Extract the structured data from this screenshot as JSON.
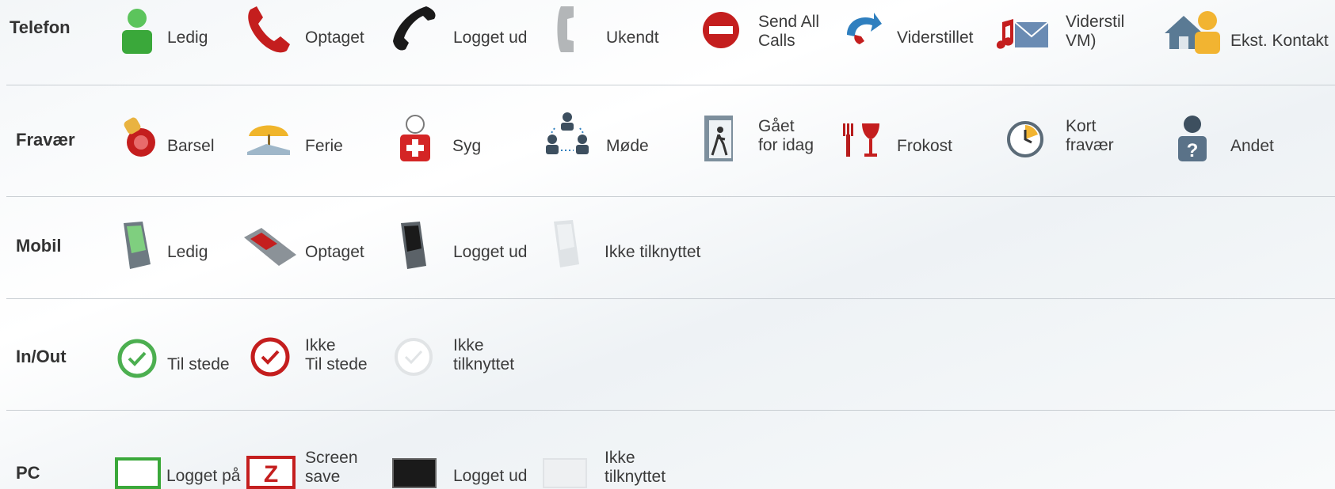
{
  "rows": [
    {
      "category": "Telefon",
      "items": [
        {
          "label": "Ledig",
          "icon": "person-green-icon"
        },
        {
          "label": "Optaget",
          "icon": "phone-red-icon"
        },
        {
          "label": "Logget ud",
          "icon": "phone-black-icon"
        },
        {
          "label": "Ukendt",
          "icon": "phone-grey-icon"
        },
        {
          "label1": "Send All",
          "label2": "Calls",
          "icon": "no-entry-icon"
        },
        {
          "label": "Viderstillet",
          "icon": "forward-icon"
        },
        {
          "label1": "Viderstil",
          "label2": " VM)",
          "icon": "voicemail-icon"
        },
        {
          "label": "Ekst. Kontakt",
          "icon": "external-contact-icon"
        }
      ]
    },
    {
      "category": "Fravær",
      "items": [
        {
          "label": "Barsel",
          "icon": "pacifier-icon"
        },
        {
          "label": "Ferie",
          "icon": "beach-icon"
        },
        {
          "label": "Syg",
          "icon": "sick-icon"
        },
        {
          "label": "Møde",
          "icon": "meeting-icon"
        },
        {
          "label1": "Gået",
          "label2": "for idag",
          "icon": "door-exit-icon"
        },
        {
          "label": "Frokost",
          "icon": "lunch-icon"
        },
        {
          "label1": "Kort",
          "label2": "fravær",
          "icon": "short-absence-clock-icon"
        },
        {
          "label": "Andet",
          "icon": "person-question-icon"
        }
      ]
    },
    {
      "category": "Mobil",
      "items": [
        {
          "label": "Ledig",
          "icon": "mobile-green-icon"
        },
        {
          "label": "Optaget",
          "icon": "mobile-red-icon"
        },
        {
          "label": "Logget ud",
          "icon": "mobile-black-icon"
        },
        {
          "label": "Ikke tilknyttet",
          "icon": "mobile-grey-icon"
        }
      ]
    },
    {
      "category": "In/Out",
      "items": [
        {
          "label": "Til stede",
          "icon": "clock-green-icon"
        },
        {
          "label1": "Ikke",
          "label2": "Til stede",
          "icon": "clock-red-icon"
        },
        {
          "label1": "Ikke",
          "label2": "tilknyttet",
          "icon": "clock-grey-icon"
        }
      ]
    },
    {
      "category": "PC",
      "items": [
        {
          "label": "Logget på",
          "icon": "monitor-green-icon"
        },
        {
          "label1": "Screen",
          "label2": "save",
          "icon": "screensaver-icon"
        },
        {
          "label": "Logget ud",
          "icon": "monitor-black-icon"
        },
        {
          "label1": "Ikke",
          "label2": "tilknyttet",
          "icon": "monitor-grey-icon"
        }
      ]
    }
  ],
  "colors": {
    "separator": "#c9ced3",
    "text": "#3b3b3b",
    "green": "#3aa83a",
    "red": "#c41e1e"
  }
}
